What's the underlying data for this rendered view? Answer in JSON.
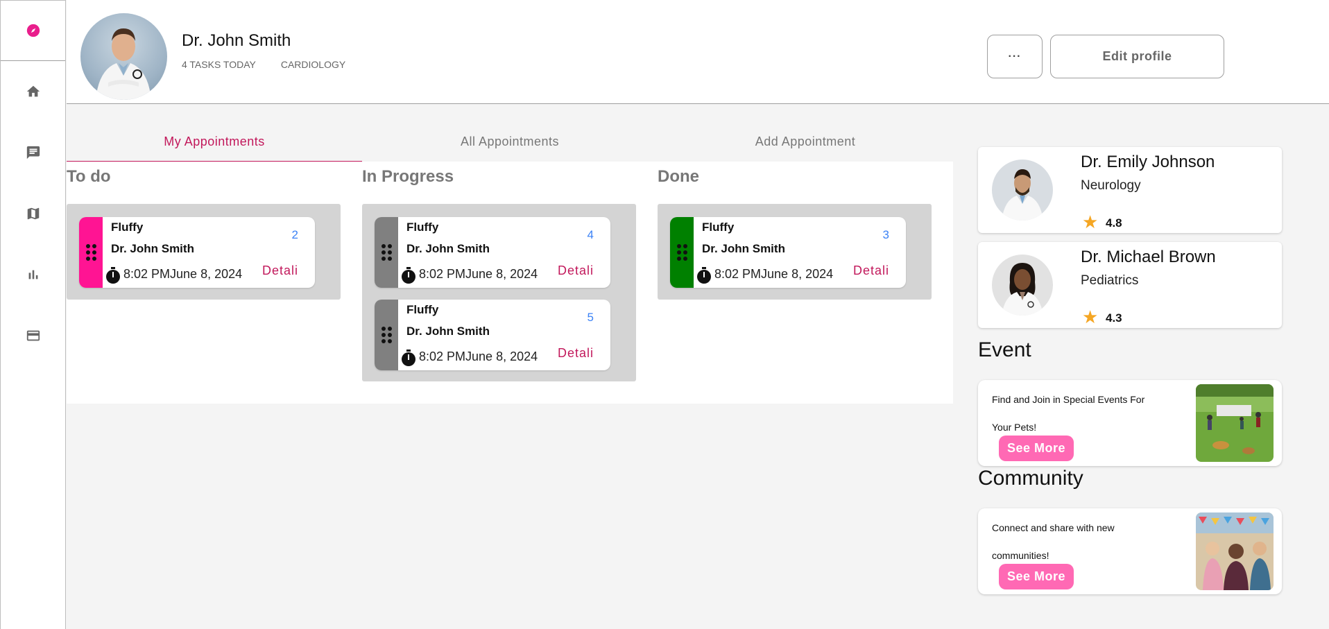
{
  "profile": {
    "name": "Dr. John Smith",
    "tasks_today": "4 TASKS TODAY",
    "department": "CARDIOLOGY",
    "more_label": "···",
    "edit_label": "Edit profile"
  },
  "tabs": [
    {
      "label": "My Appointments",
      "active": true
    },
    {
      "label": "All Appointments",
      "active": false
    },
    {
      "label": "Add Appointment",
      "active": false
    }
  ],
  "columns": {
    "todo": {
      "title": "To do",
      "cards": [
        {
          "pet": "Fluffy",
          "doctor": "Dr. John Smith",
          "number": "2",
          "time": "8:02 PMJune 8, 2024",
          "detail": "Detali",
          "color": "#ff1493"
        }
      ]
    },
    "progress": {
      "title": "In Progress",
      "cards": [
        {
          "pet": "Fluffy",
          "doctor": "Dr. John Smith",
          "number": "4",
          "time": "8:02 PMJune 8, 2024",
          "detail": "Detali",
          "color": "#808080"
        },
        {
          "pet": "Fluffy",
          "doctor": "Dr. John Smith",
          "number": "5",
          "time": "8:02 PMJune 8, 2024",
          "detail": "Detali",
          "color": "#808080"
        }
      ]
    },
    "done": {
      "title": "Done",
      "cards": [
        {
          "pet": "Fluffy",
          "doctor": "Dr. John Smith",
          "number": "3",
          "time": "8:02 PMJune 8, 2024",
          "detail": "Detali",
          "color": "#008000"
        }
      ]
    }
  },
  "doctors": [
    {
      "name": "Dr. Emily Johnson",
      "specialty": "Neurology",
      "rating": "4.8"
    },
    {
      "name": "Dr. Michael Brown",
      "specialty": "Pediatrics",
      "rating": "4.3"
    }
  ],
  "event": {
    "title": "Event",
    "text": "Find and Join in Special Events For Your Pets!",
    "button": "See More"
  },
  "community": {
    "title": "Community",
    "text": "Connect and share with new communities!",
    "button": "See More"
  },
  "colors": {
    "accent": "#c2185b",
    "pink_button": "#ff69b4",
    "todo": "#ff1493",
    "progress": "#808080",
    "done": "#008000",
    "star": "#f5a623"
  },
  "icons": [
    "compass-icon",
    "home-icon",
    "chat-icon",
    "map-icon",
    "bar-chart-icon",
    "credit-card-icon"
  ]
}
